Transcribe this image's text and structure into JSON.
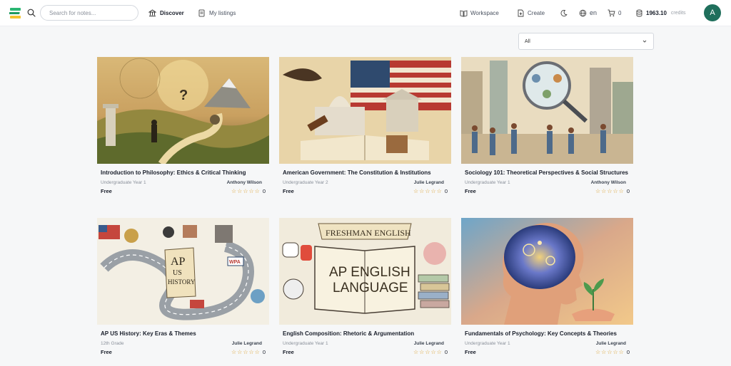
{
  "header": {
    "search_placeholder": "Search for notes...",
    "nav": [
      {
        "label": "Discover",
        "icon": "bank-icon",
        "active": true
      },
      {
        "label": "My listings",
        "icon": "document-icon",
        "active": false
      }
    ],
    "workspace_label": "Workspace",
    "create_label": "Create",
    "language": "en",
    "cart_count": "0",
    "credits_value": "1963.10",
    "credits_label": "credits",
    "avatar_initial": "A"
  },
  "filter": {
    "selected": "All"
  },
  "colors": {
    "accent": "#1f6f5c",
    "star": "#d99a1e",
    "logo_green": "#2bb673"
  },
  "cards": [
    {
      "title": "Introduction to Philosophy: Ethics & Critical Thinking",
      "level": "Undergraduate Year 1",
      "author": "Anthony Wilson",
      "price": "Free",
      "rating_count": "0",
      "stars": 0,
      "image": "philosophy-illustration"
    },
    {
      "title": "American Government: The Constitution & Institutions",
      "level": "Undergraduate Year 2",
      "author": "Julie Legrand",
      "price": "Free",
      "rating_count": "0",
      "stars": 0,
      "image": "american-government-illustration"
    },
    {
      "title": "Sociology 101: Theoretical Perspectives & Social Structures",
      "level": "Undergraduate Year 1",
      "author": "Anthony Wilson",
      "price": "Free",
      "rating_count": "0",
      "stars": 0,
      "image": "sociology-illustration"
    },
    {
      "title": "AP US History: Key Eras & Themes",
      "level": "12th Grade",
      "author": "Julie Legrand",
      "price": "Free",
      "rating_count": "0",
      "stars": 0,
      "image": "ap-us-history-illustration",
      "image_text": [
        "AP",
        "US",
        "HISTORY",
        "WPA"
      ]
    },
    {
      "title": "English Composition: Rhetoric & Argumentation",
      "level": "Undergraduate Year 1",
      "author": "Julie Legrand",
      "price": "Free",
      "rating_count": "0",
      "stars": 0,
      "image": "ap-english-illustration",
      "image_text": [
        "FRESHMAN ENGLISH",
        "AP ENGLISH",
        "LANGUAGE"
      ]
    },
    {
      "title": "Fundamentals of Psychology: Key Concepts & Theories",
      "level": "Undergraduate Year 1",
      "author": "Julie Legrand",
      "price": "Free",
      "rating_count": "0",
      "stars": 0,
      "image": "psychology-illustration"
    }
  ]
}
